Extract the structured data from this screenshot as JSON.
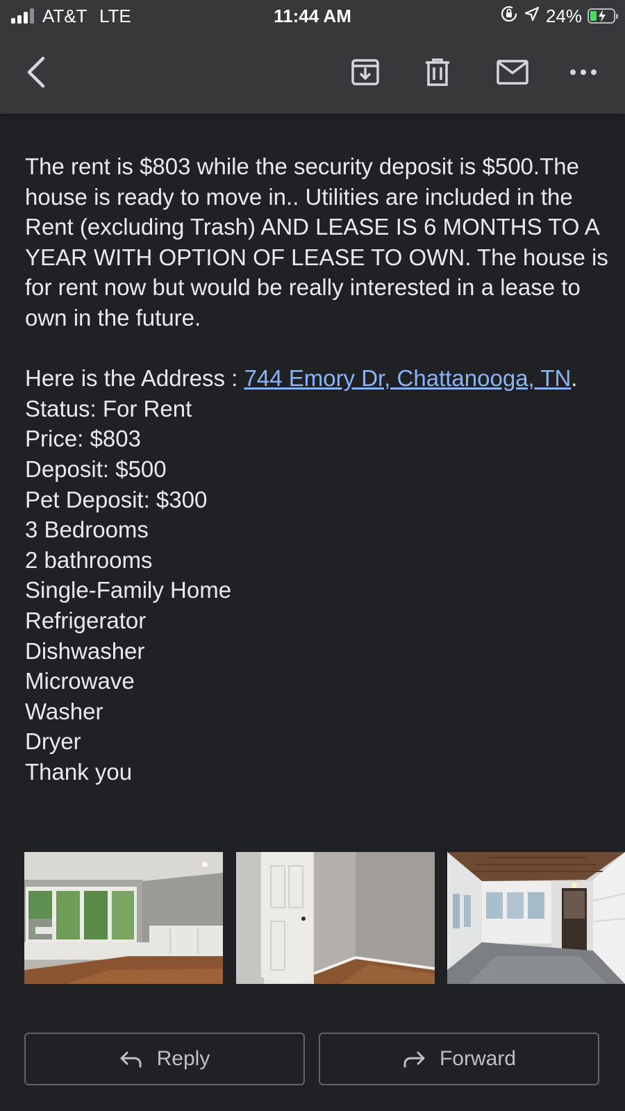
{
  "status_bar": {
    "carrier": "AT&T",
    "network": "LTE",
    "time": "11:44 AM",
    "battery_percent": "24%"
  },
  "toolbar": {
    "back_icon": "chevron-left-icon",
    "archive_icon": "archive-icon",
    "delete_icon": "trash-icon",
    "mark_unread_icon": "mail-icon",
    "more_icon": "more-horizontal-icon"
  },
  "email": {
    "paragraph_rent": "The rent is $803 while the security deposit is $500.The house is ready to move in.. Utilities are included in the Rent (excluding Trash) AND LEASE IS 6 MONTHS TO A YEAR WITH OPTION OF LEASE TO OWN. The house is for rent now but would be really interested in a lease to own in the future.",
    "address_prefix": "Here is the Address : ",
    "address_link": "744 Emory Dr, Chattanooga, TN",
    "address_suffix": ".",
    "details": [
      "Status: For Rent",
      "Price: $803",
      "Deposit: $500",
      "Pet Deposit: $300",
      "3 Bedrooms",
      "2 bathrooms",
      "Single-Family Home",
      "Refrigerator",
      "Dishwasher",
      "Microwave",
      "Washer",
      "Dryer",
      "Thank you"
    ]
  },
  "attachments": [
    {
      "subject": "living room with windows and hardwood floor"
    },
    {
      "subject": "bedroom corner with white door"
    },
    {
      "subject": "sunroom with wood ceiling"
    }
  ],
  "actions": {
    "reply_label": "Reply",
    "forward_label": "Forward",
    "reply_icon": "reply-arrow-icon",
    "forward_icon": "forward-arrow-icon"
  },
  "colors": {
    "background": "#202124",
    "text": "#e8eaed",
    "link": "#8ab4f8",
    "button_border": "#5f6368",
    "battery_green": "#4cd964"
  }
}
